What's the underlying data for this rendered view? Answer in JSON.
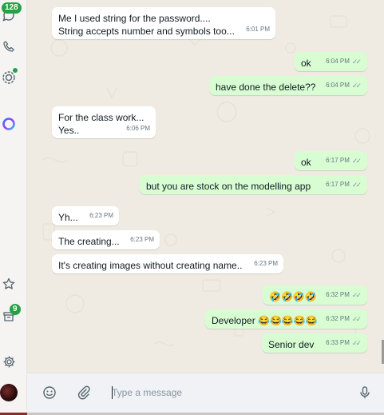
{
  "rail": {
    "chats_badge": "128",
    "archived_badge": "9"
  },
  "messages": [
    {
      "dir": "in",
      "text": "Me I used string for the password....\nString accepts number and symbols too...",
      "time": "6:01 PM"
    },
    {
      "dir": "out",
      "text": "ok",
      "time": "6:04 PM"
    },
    {
      "dir": "out",
      "text": "have done the delete??",
      "time": "6:04 PM"
    },
    {
      "dir": "in",
      "text": "For the class work...\nYes..",
      "time": "6:06 PM"
    },
    {
      "dir": "out",
      "text": "ok",
      "time": "6:17 PM"
    },
    {
      "dir": "out",
      "text": "but you are stock on the modelling app",
      "time": "6:17 PM"
    },
    {
      "dir": "in",
      "text": "Yh...",
      "time": "6:23 PM"
    },
    {
      "dir": "in",
      "text": "The creating...",
      "time": "6:23 PM"
    },
    {
      "dir": "in",
      "text": "It's creating images without creating name..",
      "time": "6:23 PM"
    },
    {
      "dir": "out",
      "text": "🤣🤣🤣🤣",
      "time": "6:32 PM"
    },
    {
      "dir": "out",
      "text": "Developer 😂😂😂😂😂",
      "time": "6:32 PM"
    },
    {
      "dir": "out",
      "text": "Senior dev",
      "time": "6:33 PM"
    }
  ],
  "composer": {
    "placeholder": "Type a message"
  },
  "icons": {
    "chats": "chat-icon",
    "calls": "phone-icon",
    "status": "status-icon",
    "meta_ai": "meta-ai-icon",
    "starred": "star-icon",
    "archived": "archive-icon",
    "settings": "gear-icon",
    "emoji": "emoji-icon",
    "attach": "paperclip-icon",
    "mic": "microphone-icon"
  },
  "colors": {
    "incoming": "#ffffff",
    "outgoing": "#d9fdd3",
    "background": "#efeae2",
    "badge": "#25a244"
  }
}
